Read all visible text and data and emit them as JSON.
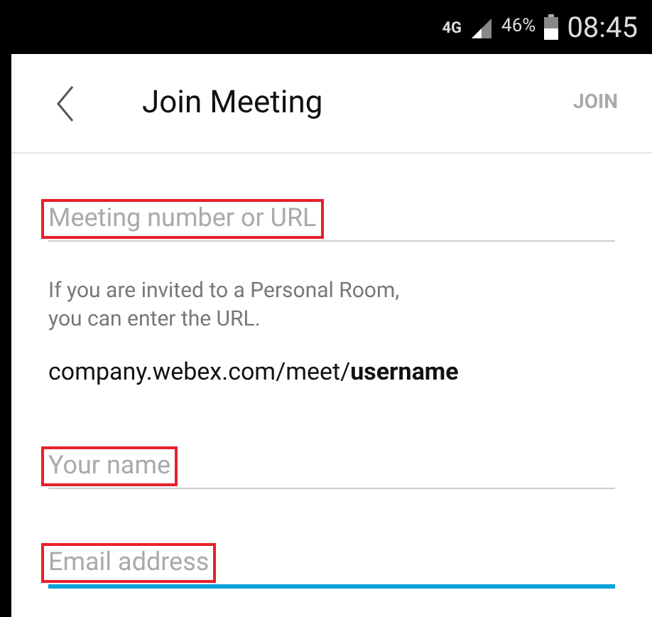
{
  "status_bar": {
    "network": "4G",
    "battery": "46%",
    "time": "08:45"
  },
  "header": {
    "title": "Join Meeting",
    "action": {
      "label": "JOIN",
      "disabled": true
    }
  },
  "fields": [
    {
      "placeholder": "Meeting number or URL",
      "highlighted": true,
      "focused": false
    },
    {
      "hint": "If you are invited to a Personal Room,\nyou can enter the URL.",
      "example": "company.webex.com/meet/**username**"
    },
    {
      "placeholder": "Your name",
      "highlighted": true,
      "focused": false
    },
    {
      "placeholder": "Email address",
      "highlighted": true,
      "focused": true
    }
  ]
}
